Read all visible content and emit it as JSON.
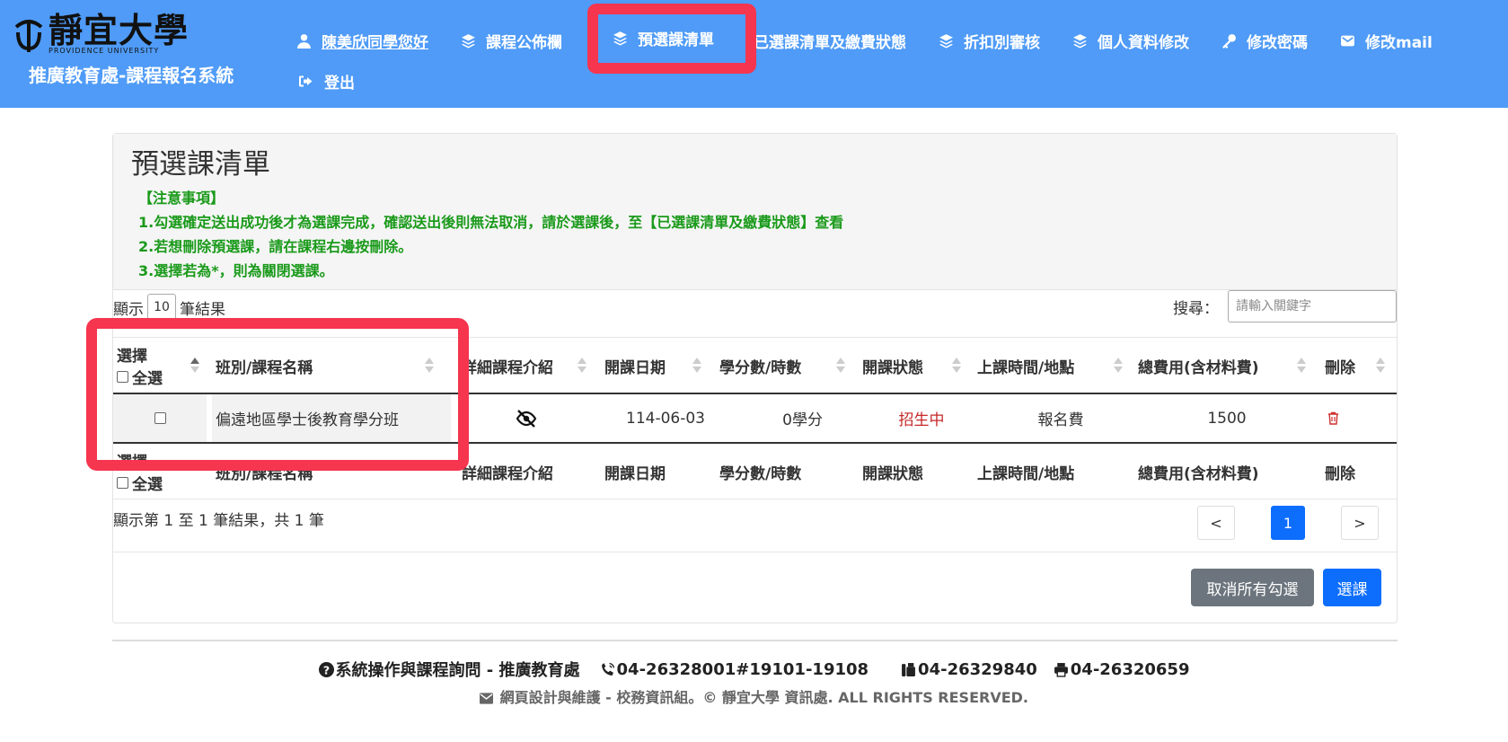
{
  "header": {
    "logo_cn": "靜宜大學",
    "logo_en": "PROVIDENCE UNIVERSITY",
    "system_title": "推廣教育處-課程報名系統",
    "nav": [
      {
        "label": "陳美欣同學您好",
        "icon": "user-icon"
      },
      {
        "label": "課程公佈欄",
        "icon": "layers-icon"
      },
      {
        "label": "預選課清單",
        "icon": "layers-icon"
      },
      {
        "label": "已選課清單及繳費狀態",
        "icon": "layers-icon"
      },
      {
        "label": "折扣別審核",
        "icon": "layers-icon"
      },
      {
        "label": "個人資料修改",
        "icon": "layers-icon"
      },
      {
        "label": "修改密碼",
        "icon": "key-icon"
      },
      {
        "label": "修改mail",
        "icon": "envelope-icon"
      }
    ],
    "logout": "登出"
  },
  "page": {
    "title": "預選課清單",
    "notes": [
      "【注意事項】",
      "1.勾選確定送出成功後才為選課完成，確認送出後則無法取消，請於選課後，至【已選課清單及繳費狀態】查看",
      "2.若想刪除預選課，請在課程右邊按刪除。",
      "3.選擇若為*，則為關閉選課。"
    ]
  },
  "controls": {
    "show_prefix": "顯示",
    "show_value": "10",
    "show_suffix": "筆結果",
    "search_label": "搜尋：",
    "search_placeholder": "請輸入關鍵字"
  },
  "table": {
    "select_header": "選擇",
    "select_all": "全選",
    "columns": [
      "班別/課程名稱",
      "詳細課程介紹",
      "開課日期",
      "學分數/時數",
      "開課狀態",
      "上課時間/地點",
      "總費用(含材料費)",
      "刪除"
    ],
    "rows": [
      {
        "name": "偏遠地區學士後教育學分班",
        "intro_icon": "eye-slash-icon",
        "date": "114-06-03",
        "credits": "0學分",
        "status": "招生中",
        "time_place": "報名費",
        "fee": "1500",
        "delete_icon": "trash-icon"
      }
    ],
    "info": "顯示第 1 至 1 筆結果，共 1 筆",
    "pager": {
      "prev": "<",
      "page": "1",
      "next": ">"
    }
  },
  "buttons": {
    "cancel_all": "取消所有勾選",
    "select": "選課"
  },
  "footer": {
    "inquiry": "系統操作與課程詢問 - 推廣教育處",
    "phone": "04-26328001#19101-19108",
    "tel2": "04-26329840",
    "fax": "04-26320659",
    "credits": "網頁設計與維護 - 校務資訊組。© 靜宜大學 資訊處. ALL RIGHTS RESERVED."
  },
  "colors": {
    "header_bg": "#4f9bf7",
    "highlight": "#f6354f",
    "notes_green": "#1a9a1a",
    "status_red": "#c62828",
    "primary": "#0d6efd",
    "secondary": "#6c757d"
  }
}
